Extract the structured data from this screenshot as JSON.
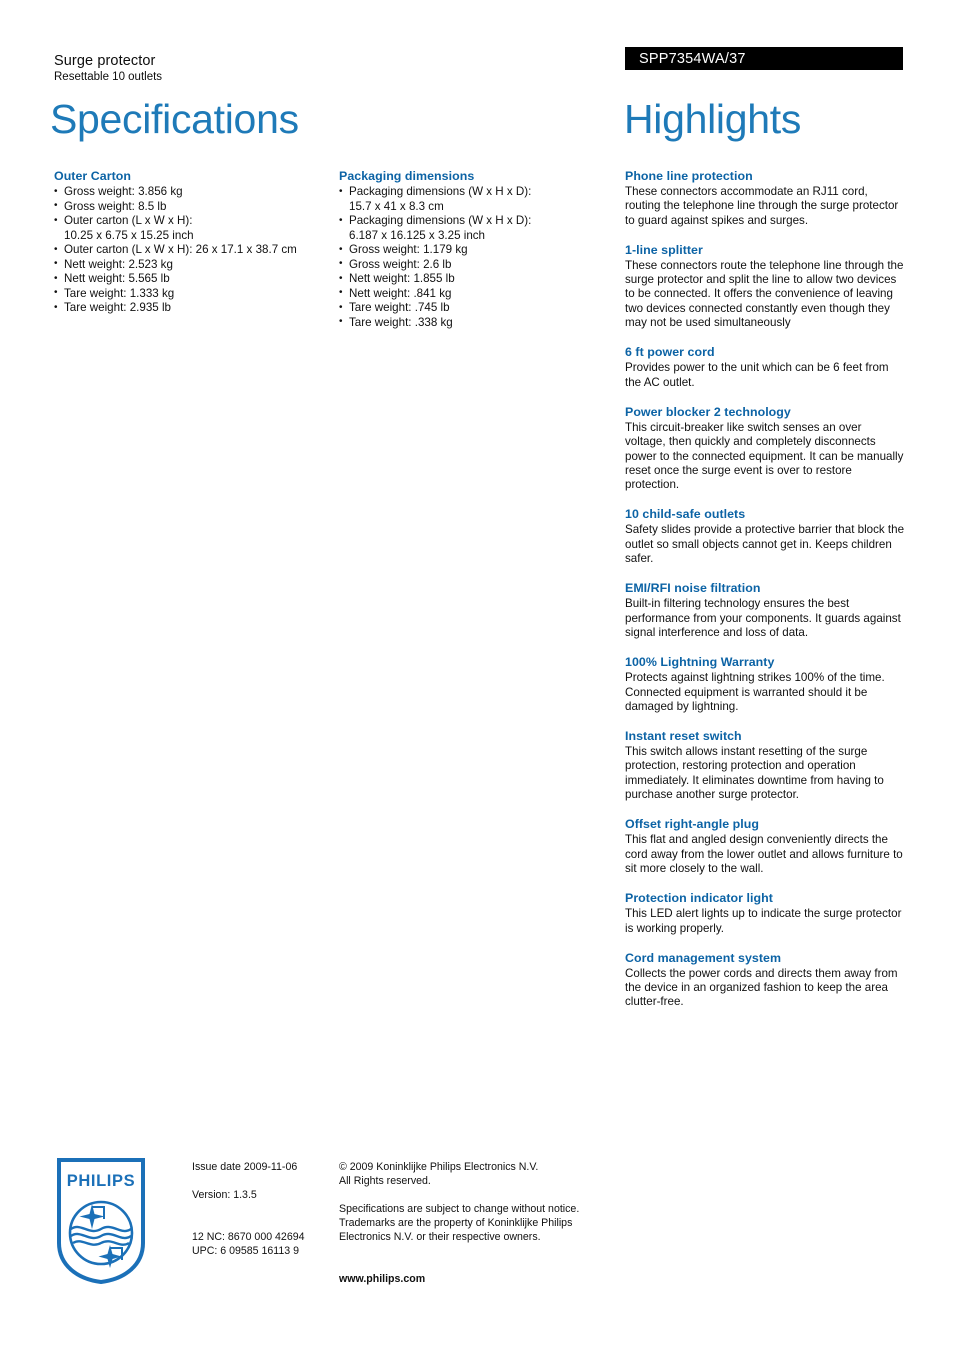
{
  "header": {
    "product_name": "Surge protector",
    "product_subtitle": "Resettable 10 outlets",
    "product_code": "SPP7354WA/37",
    "left_title": "Specifications",
    "right_title": "Highlights"
  },
  "specifications": {
    "outer_carton": {
      "heading": "Outer Carton",
      "items": [
        {
          "text": "Gross weight: 3.856 kg",
          "cont": ""
        },
        {
          "text": "Gross weight: 8.5 lb",
          "cont": ""
        },
        {
          "text": "Outer carton (L x W x H):",
          "cont": "10.25 x 6.75 x 15.25 inch"
        },
        {
          "text": "Outer carton (L x W x H): 26 x 17.1 x 38.7 cm",
          "cont": ""
        },
        {
          "text": "Nett weight: 2.523 kg",
          "cont": ""
        },
        {
          "text": "Nett weight: 5.565 lb",
          "cont": ""
        },
        {
          "text": "Tare weight: 1.333 kg",
          "cont": ""
        },
        {
          "text": "Tare weight: 2.935 lb",
          "cont": ""
        }
      ]
    },
    "packaging_dimensions": {
      "heading": "Packaging dimensions",
      "items": [
        {
          "text": "Packaging dimensions (W x H x D):",
          "cont": "15.7 x 41 x 8.3 cm"
        },
        {
          "text": "Packaging dimensions (W x H x D):",
          "cont": "6.187 x 16.125 x 3.25 inch"
        },
        {
          "text": "Gross weight: 1.179 kg",
          "cont": ""
        },
        {
          "text": "Gross weight: 2.6 lb",
          "cont": ""
        },
        {
          "text": "Nett weight: 1.855 lb",
          "cont": ""
        },
        {
          "text": "Nett weight: .841 kg",
          "cont": ""
        },
        {
          "text": "Tare weight: .745 lb",
          "cont": ""
        },
        {
          "text": "Tare weight: .338 kg",
          "cont": ""
        }
      ]
    }
  },
  "highlights": [
    {
      "title": "Phone line protection",
      "body": "These connectors accommodate an RJ11 cord, routing the telephone line through the surge protector to guard against spikes and surges."
    },
    {
      "title": "1-line splitter",
      "body": "These connectors route the telephone line through the surge protector and split the line to allow two devices to be connected. It offers the convenience of leaving two devices connected constantly even though they may not be used simultaneously"
    },
    {
      "title": "6 ft power cord",
      "body": "Provides power to the unit which can be 6 feet from the AC outlet."
    },
    {
      "title": "Power blocker 2 technology",
      "body": "This circuit-breaker like switch senses an over voltage, then quickly and completely disconnects power to the connected equipment. It can be manually reset once the surge event is over to restore protection."
    },
    {
      "title": "10 child-safe outlets",
      "body": "Safety slides provide a protective barrier that block the outlet so small objects cannot get in. Keeps children safer."
    },
    {
      "title": "EMI/RFI noise filtration",
      "body": "Built-in filtering technology ensures the best performance from your components. It guards against signal interference and loss of data."
    },
    {
      "title": "100% Lightning Warranty",
      "body": "Protects against lightning strikes 100% of the time. Connected equipment is warranted should it be damaged by lightning."
    },
    {
      "title": "Instant reset switch",
      "body": "This switch allows instant resetting of the surge protection, restoring protection and operation immediately. It eliminates downtime from having to purchase another surge protector."
    },
    {
      "title": "Offset right-angle plug",
      "body": "This flat and angled design conveniently directs the cord away from the lower outlet and allows furniture to sit more closely to the wall."
    },
    {
      "title": "Protection indicator light",
      "body": "This LED alert lights up to indicate the surge protector is working properly."
    },
    {
      "title": "Cord management system",
      "body": "Collects the power cords and directs them away from the device in an organized fashion to keep the area clutter-free."
    }
  ],
  "footer": {
    "logo_wordmark": "PHILIPS",
    "issue_date": "Issue date 2009-11-06",
    "version": "Version: 1.3.5",
    "nc_code": "12 NC: 8670 000 42694",
    "upc_code": "UPC: 6 09585 16113 9",
    "copyright_line1": "© 2009 Koninklijke Philips Electronics N.V.",
    "copyright_line2": "All Rights reserved.",
    "disclaimer_line1": "Specifications are subject to change without notice.",
    "disclaimer_line2": "Trademarks are the property of Koninklijke Philips",
    "disclaimer_line3": "Electronics N.V. or their respective owners.",
    "website": "www.philips.com"
  },
  "colors": {
    "title_blue": "#1e7ab8",
    "heading_blue": "#0c63a5",
    "code_bar_bg": "#000000",
    "logo_blue": "#1b70b8"
  }
}
